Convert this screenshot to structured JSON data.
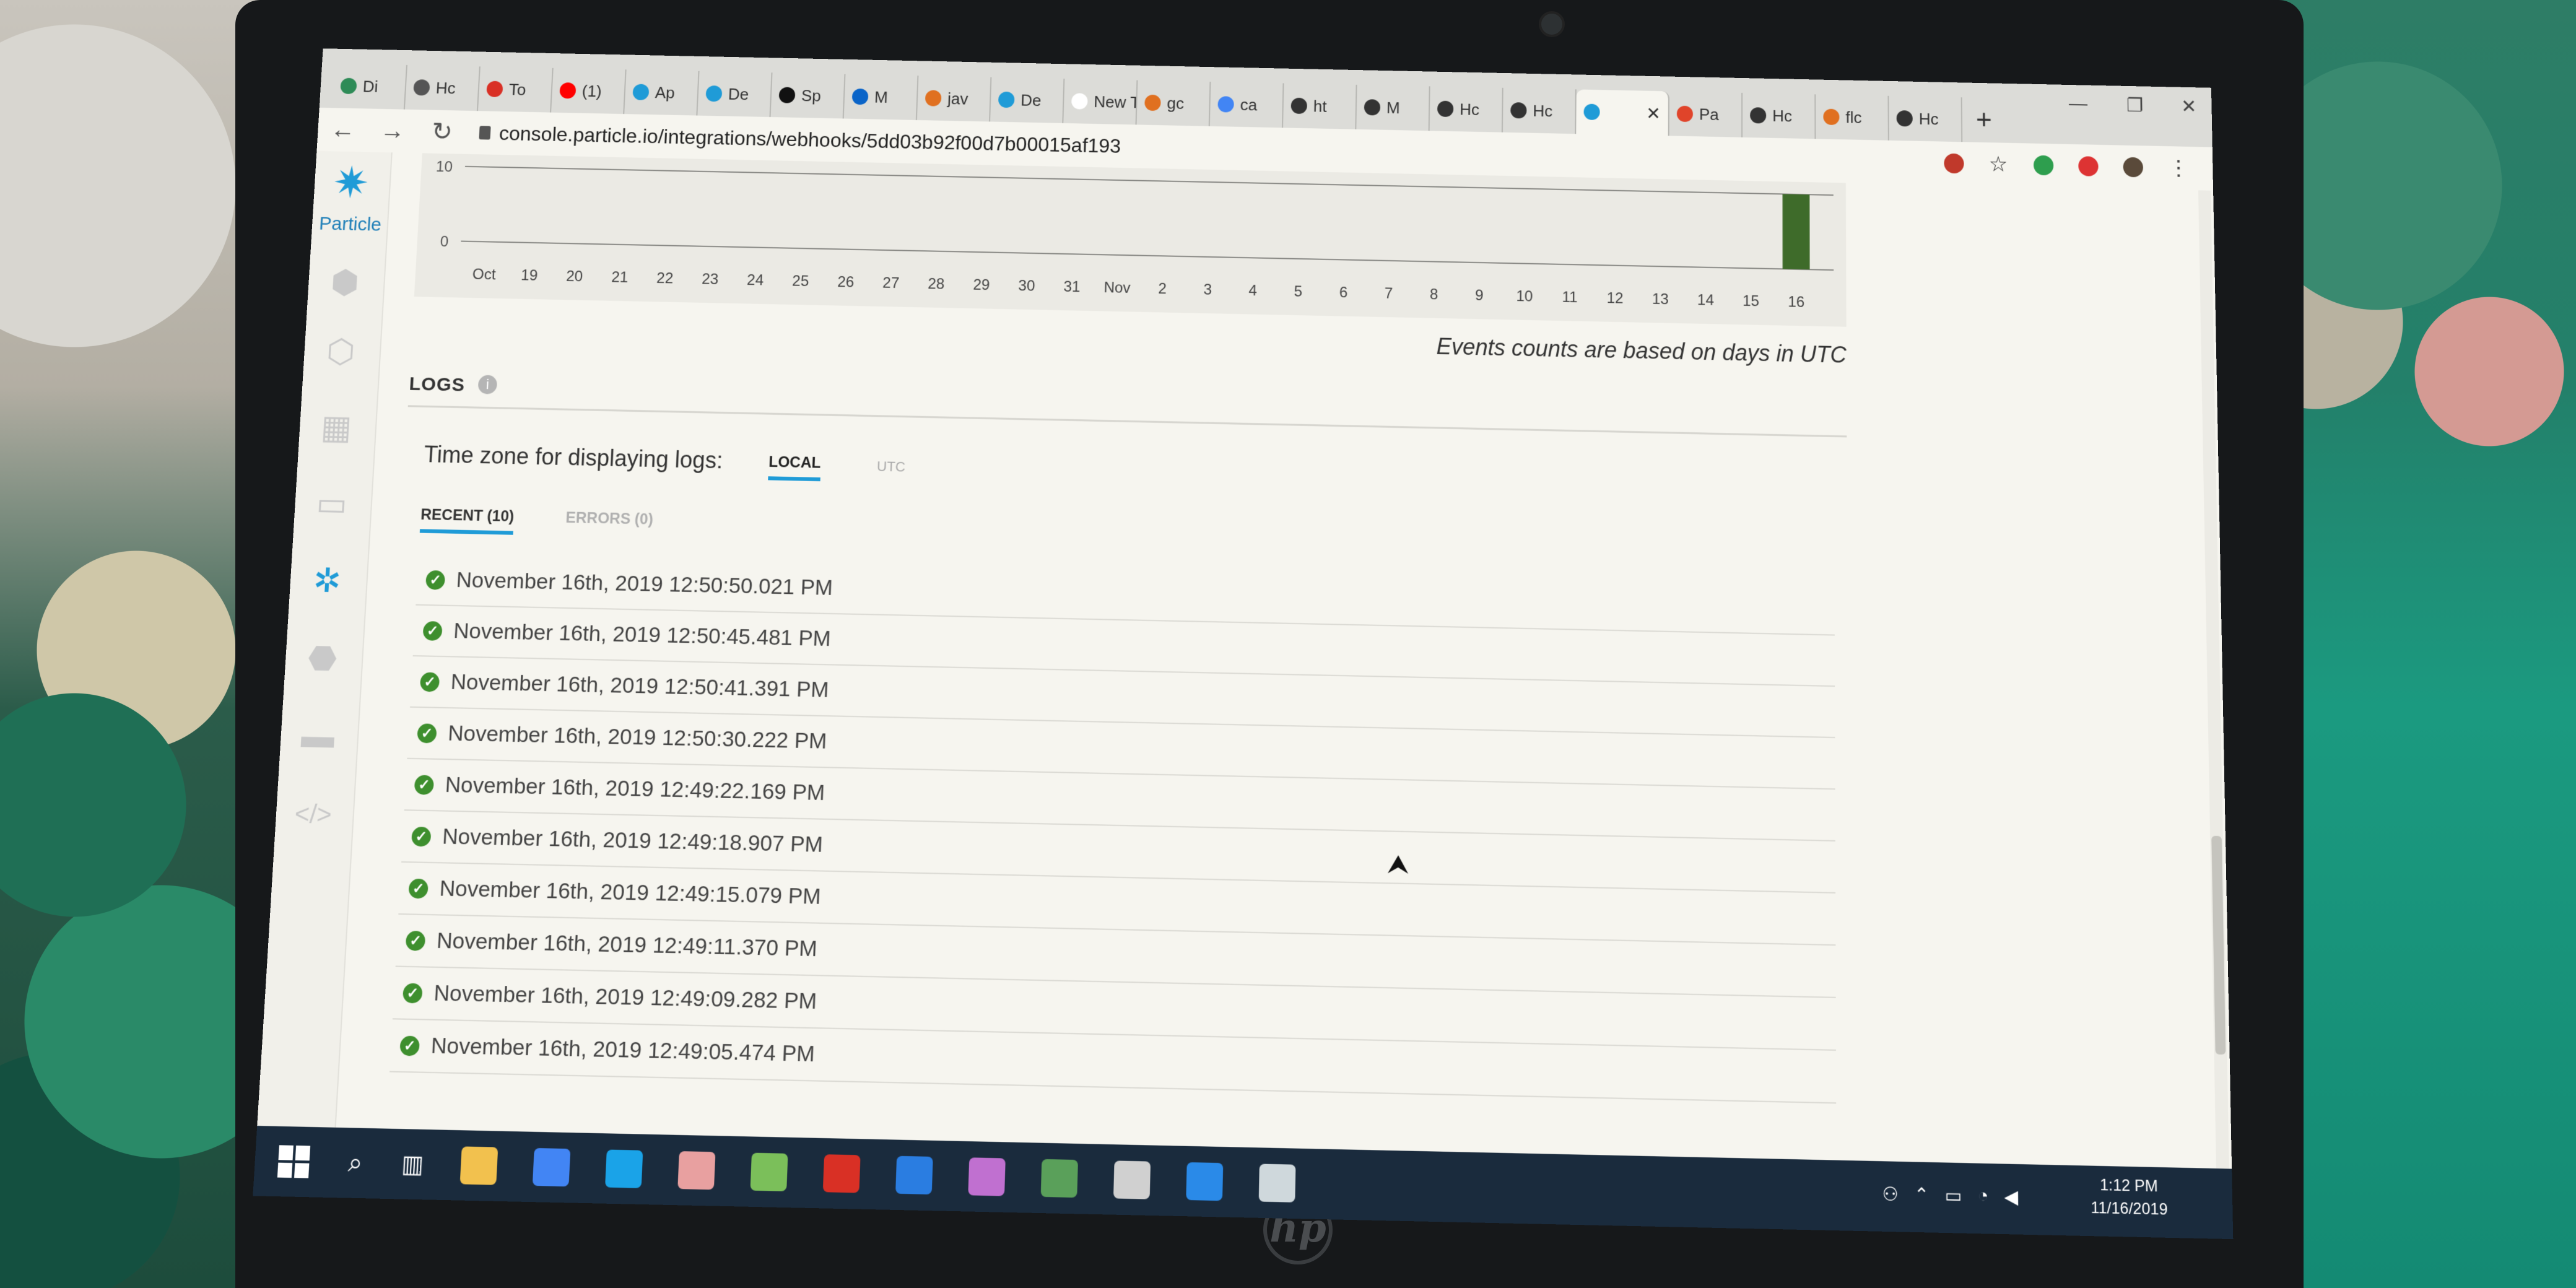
{
  "browser": {
    "tabs": [
      {
        "label": "Di",
        "color": "#2e8b57"
      },
      {
        "label": "Hc",
        "color": "#555555"
      },
      {
        "label": "To",
        "color": "#d93025"
      },
      {
        "label": "(1)",
        "color": "#ff0000"
      },
      {
        "label": "Ap",
        "color": "#1f9bd7"
      },
      {
        "label": "De",
        "color": "#1f9bd7"
      },
      {
        "label": "Sp",
        "color": "#111111"
      },
      {
        "label": "M",
        "color": "#0a64c8"
      },
      {
        "label": "jav",
        "color": "#e07020"
      },
      {
        "label": "De",
        "color": "#1f9bd7"
      },
      {
        "label": "New T",
        "color": "#ffffff"
      },
      {
        "label": "gc",
        "color": "#e07020"
      },
      {
        "label": "ca",
        "color": "#4285f4"
      },
      {
        "label": "ht",
        "color": "#333333"
      },
      {
        "label": "M",
        "color": "#333333"
      },
      {
        "label": "Hc",
        "color": "#333333"
      },
      {
        "label": "Hc",
        "color": "#333333"
      },
      {
        "label": "",
        "color": "#1f9bd7",
        "active": true
      },
      {
        "label": "Pa",
        "color": "#e0442a"
      },
      {
        "label": "Hc",
        "color": "#333333"
      },
      {
        "label": "flc",
        "color": "#e07020"
      },
      {
        "label": "Hc",
        "color": "#333333"
      }
    ],
    "url": "console.particle.io/integrations/webhooks/5dd03b92f00d7b00015af193"
  },
  "sidebar": {
    "brand": "Particle"
  },
  "chart_data": {
    "type": "bar",
    "categories": [
      "Oct",
      "19",
      "20",
      "21",
      "22",
      "23",
      "24",
      "25",
      "26",
      "27",
      "28",
      "29",
      "30",
      "31",
      "Nov",
      "2",
      "3",
      "4",
      "5",
      "6",
      "7",
      "8",
      "9",
      "10",
      "11",
      "12",
      "13",
      "14",
      "15",
      "16"
    ],
    "values": [
      0,
      0,
      0,
      0,
      0,
      0,
      0,
      0,
      0,
      0,
      0,
      0,
      0,
      0,
      0,
      0,
      0,
      0,
      0,
      0,
      0,
      0,
      0,
      0,
      0,
      0,
      0,
      0,
      0,
      10
    ],
    "yticks": [
      "10",
      "0"
    ],
    "ylim": [
      0,
      10
    ],
    "bar_color": "#3e6b2a"
  },
  "logs": {
    "note": "Events counts are based on days in UTC",
    "title": "LOGS",
    "info": "i",
    "tz_label": "Time zone for displaying logs:",
    "tz_local": "LOCAL",
    "tz_utc": "UTC",
    "tab_recent": "RECENT (10)",
    "tab_errors": "ERRORS (0)",
    "entries": [
      "November 16th, 2019 12:50:50.021 PM",
      "November 16th, 2019 12:50:45.481 PM",
      "November 16th, 2019 12:50:41.391 PM",
      "November 16th, 2019 12:50:30.222 PM",
      "November 16th, 2019 12:49:22.169 PM",
      "November 16th, 2019 12:49:18.907 PM",
      "November 16th, 2019 12:49:15.079 PM",
      "November 16th, 2019 12:49:11.370 PM",
      "November 16th, 2019 12:49:09.282 PM",
      "November 16th, 2019 12:49:05.474 PM"
    ]
  },
  "taskbar": {
    "time": "1:12 PM",
    "date": "11/16/2019",
    "icon_colors": [
      "#f2c14e",
      "#4285f4",
      "#1aa3e8",
      "#e8a0a0",
      "#7bbf5a",
      "#d93025",
      "#2a7de1",
      "#c070d0",
      "#5aa05a",
      "#d0d0d0",
      "#2a8ae8",
      "#cfd8dc"
    ]
  }
}
